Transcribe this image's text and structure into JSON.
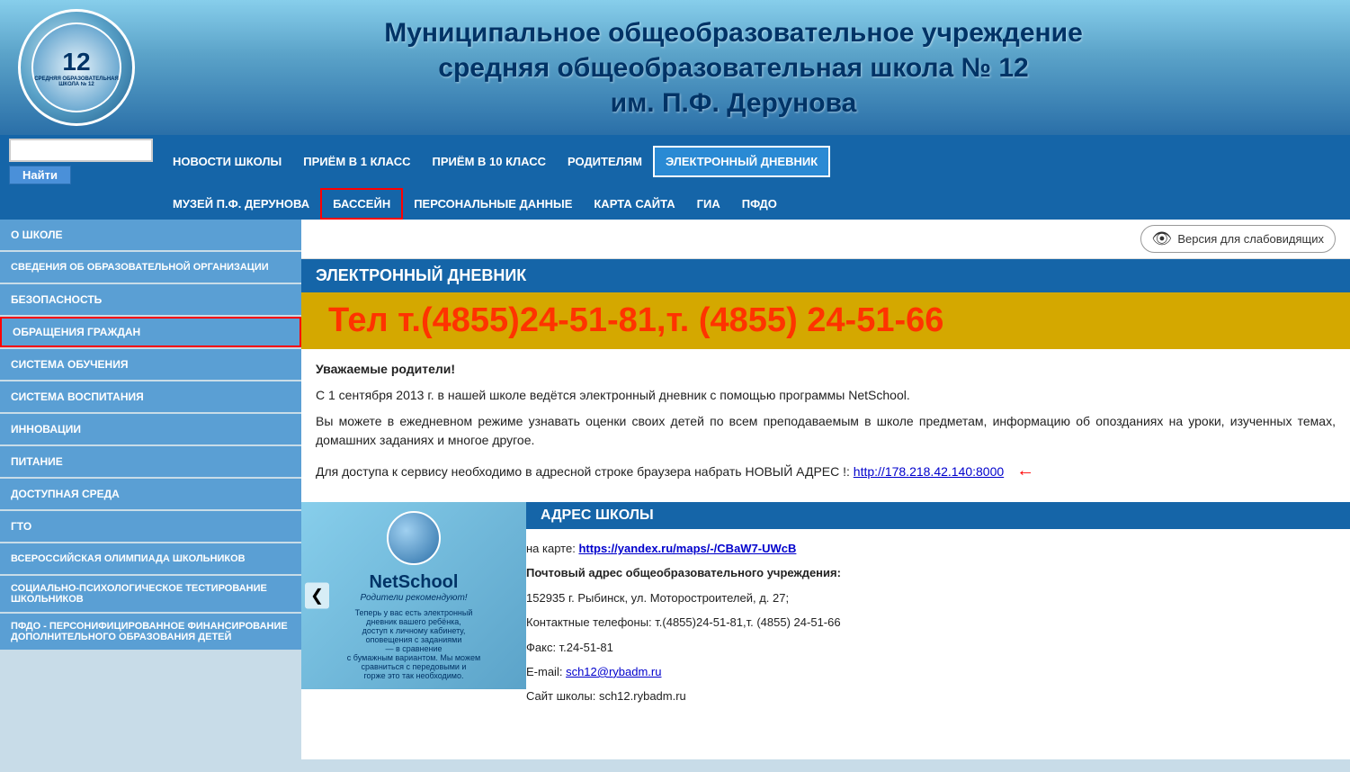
{
  "header": {
    "title_line1": "Муниципальное общеобразовательное  учреждение",
    "title_line2": "средняя общеобразовательная школа № 12",
    "title_line3": "им. П.Ф. Дерунова",
    "logo_num": "12"
  },
  "nav": {
    "search_placeholder": "",
    "search_btn": "Найти",
    "row1": [
      {
        "label": "НОВОСТИ ШКОЛЫ",
        "active": false
      },
      {
        "label": "ПРИЁМ В 1 КЛАСС",
        "active": false
      },
      {
        "label": "ПРИЁМ В 10 КЛАСС",
        "active": false
      },
      {
        "label": "РОДИТЕЛЯМ",
        "active": false
      },
      {
        "label": "ЭЛЕКТРОННЫЙ ДНЕВНИК",
        "active": true,
        "highlighted": true
      }
    ],
    "row2": [
      {
        "label": "МУЗЕЙ П.Ф. ДЕРУНОВА",
        "active": false
      },
      {
        "label": "БАССЕЙН",
        "active": false,
        "outlined": true
      },
      {
        "label": "ПЕРСОНАЛЬНЫЕ ДАННЫЕ",
        "active": false
      },
      {
        "label": "КАРТА САЙТА",
        "active": false
      },
      {
        "label": "ГИА",
        "active": false
      },
      {
        "label": "ПФДО",
        "active": false
      }
    ]
  },
  "sidebar": {
    "items": [
      {
        "label": "О ШКОЛЕ",
        "outlined": false
      },
      {
        "label": "СВЕДЕНИЯ ОБ ОБРАЗОВАТЕЛЬНОЙ ОРГАНИЗАЦИИ",
        "outlined": false
      },
      {
        "label": "БЕЗОПАСНОСТЬ",
        "outlined": false
      },
      {
        "label": "ОБРАЩЕНИЯ ГРАЖДАН",
        "outlined": true
      },
      {
        "label": "СИСТЕМА ОБУЧЕНИЯ",
        "outlined": false
      },
      {
        "label": "СИСТЕМА ВОСПИТАНИЯ",
        "outlined": false
      },
      {
        "label": "ИННОВАЦИИ",
        "outlined": false
      },
      {
        "label": "ПИТАНИЕ",
        "outlined": false
      },
      {
        "label": "ДОСТУПНАЯ СРЕДА",
        "outlined": false
      },
      {
        "label": "ГТО",
        "outlined": false
      },
      {
        "label": "ВСЕРОССИЙСКАЯ ОЛИМПИАДА ШКОЛЬНИКОВ",
        "outlined": false
      },
      {
        "label": "СОЦИАЛЬНО-ПСИХОЛОГИЧЕСКОЕ ТЕСТИРОВАНИЕ ШКОЛЬНИКОВ",
        "outlined": false
      },
      {
        "label": "ПФДО - ПЕРСОНИФИЦИРОВАННОЕ ФИНАНСИРОВАНИЕ ДОПОЛНИТЕЛЬНОГО ОБРАЗОВАНИЯ ДЕТЕЙ",
        "outlined": false
      }
    ]
  },
  "content": {
    "section_title": "ЭЛЕКТРОННЫЙ ДНЕВНИК",
    "para1": "Уважаемые родители!",
    "para2": "С 1 сентября 2013 г. в нашей школе ведётся электронный дневник с помощью программы NetSchool.",
    "para3": "Вы можете в ежедневном режиме узнавать оценки своих детей по всем преподаваемым в школе предметам, информацию об опозданиях на уроки, изученных темах, домашних заданиях и многое другое.",
    "para4_prefix": "Для доступа к сервису необходимо в адресной строке браузера набрать НОВЫЙ АДРЕС !: ",
    "para4_link": "http://178.218.42.140:8000",
    "version_btn": "Версия для слабовидящих"
  },
  "phone": {
    "text": "Тел т.(4855)24-51-81,т. (4855) 24-51-66"
  },
  "address": {
    "section_title": "АДРЕС ШКОЛЫ",
    "map_text": "на карте: ",
    "map_link": "https://yandex.ru/maps/-/CBaW7-UWcB",
    "lines": [
      "Почтовый адрес общеобразовательного учреждения:",
      "152935 г. Рыбинск, ул. Моторостроителей, д. 27;",
      "Контактные телефоны:  т.(4855)24-51-81,т. (4855) 24-51-66",
      "Факс: т.24-51-81",
      "E-mail: sch12@rybadm.ru",
      "Сайт школы: sch12.rybadm.ru"
    ],
    "email_link": "sch12@rybadm.ru"
  },
  "netschool": {
    "name": "NetSchool",
    "recommend": "Родители рекомендуют!"
  }
}
